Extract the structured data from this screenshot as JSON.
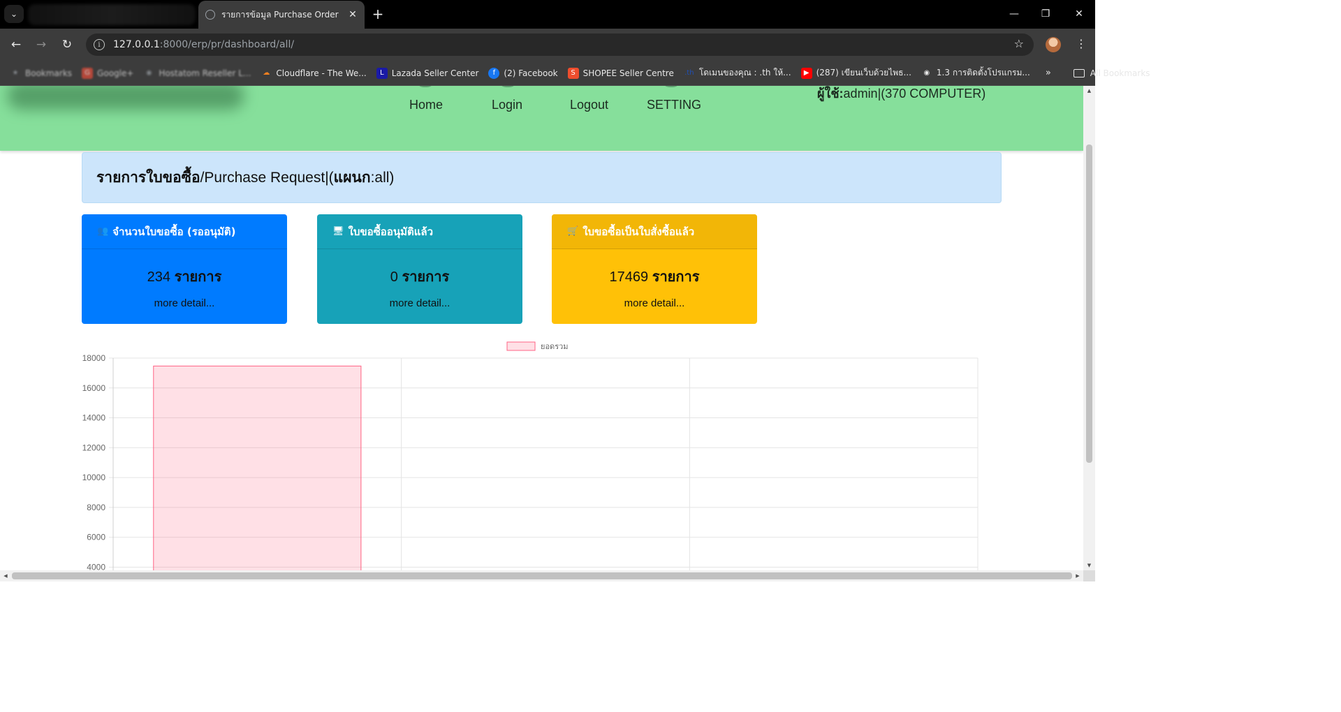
{
  "browser": {
    "tab_title": "รายการข้อมูล Purchase Order",
    "url_host": "127.0.0.1",
    "url_rest": ":8000/erp/pr/dashboard/all/",
    "bookmarks": [
      {
        "label": "Bookmarks",
        "icon": "star-icon",
        "color": "#9aa0a6",
        "blurred": true
      },
      {
        "label": "Google+",
        "icon": "google-plus-icon",
        "color": "#dd4b39",
        "blurred": true
      },
      {
        "label": "Hostatom Reseller L...",
        "icon": "globe-icon",
        "color": "#9aa0a6",
        "blurred": true
      },
      {
        "label": "Cloudflare - The We...",
        "icon": "cloudflare-icon",
        "color": "#f38020",
        "blurred": false
      },
      {
        "label": "Lazada Seller Center",
        "icon": "lazada-icon",
        "color": "#1a1aa6",
        "blurred": false
      },
      {
        "label": "(2) Facebook",
        "icon": "facebook-icon",
        "color": "#1877f2",
        "blurred": false
      },
      {
        "label": "SHOPEE Seller Centre",
        "icon": "shopee-icon",
        "color": "#ee4d2d",
        "blurred": false
      },
      {
        "label": "โดเมนของคุณ : .th ให้...",
        "icon": "th-domain-icon",
        "color": "#1f4fb5",
        "blurred": false
      },
      {
        "label": "(287) เขียนเว็บด้วยไพธ...",
        "icon": "youtube-icon",
        "color": "#ff0000",
        "blurred": false
      },
      {
        "label": "1.3 การติดตั้งโปรแกรม...",
        "icon": "globe-icon",
        "color": "#e8e8e8",
        "blurred": false
      }
    ],
    "more": "»",
    "all_bookmarks": "All Bookmarks"
  },
  "nav": {
    "links": [
      "Home",
      "Login",
      "Logout",
      "SETTING"
    ],
    "user_prefix": "ผู้ใช้:",
    "user_name": "admin|(370 COMPUTER)"
  },
  "header": {
    "title_bold": "รายการใบขอซื้อ",
    "title_rest": "/Purchase Request|(",
    "dept_bold": "แผนก",
    "dept_rest": ":all)"
  },
  "cards": [
    {
      "title": "จำนวนใบขอซื้อ (รออนุมัติ)",
      "icon": "users-icon",
      "count": "234",
      "unit": "รายการ",
      "more": "more detail...",
      "color": "#007bff"
    },
    {
      "title": "ใบขอซื้ออนุมัติแล้ว",
      "icon": "monitor-icon",
      "count": "0",
      "unit": "รายการ",
      "more": "more detail...",
      "color": "#17a2b8"
    },
    {
      "title": "ใบขอซื้อเป็นใบสั่งซื้อแล้ว",
      "icon": "cart-icon",
      "count": "17469",
      "unit": "รายการ",
      "more": "more detail...",
      "color": "#ffc107"
    }
  ],
  "chart_data": {
    "type": "bar",
    "title": "",
    "legend": "top",
    "series": [
      {
        "name": "ยอดรวม",
        "values": [
          17469,
          null,
          null
        ],
        "color": "#ff6384"
      }
    ],
    "categories": [
      "",
      "",
      ""
    ],
    "yticks": [
      4000,
      6000,
      8000,
      10000,
      12000,
      14000,
      16000,
      18000
    ],
    "ylim": [
      3600,
      18000
    ],
    "grid": true
  }
}
